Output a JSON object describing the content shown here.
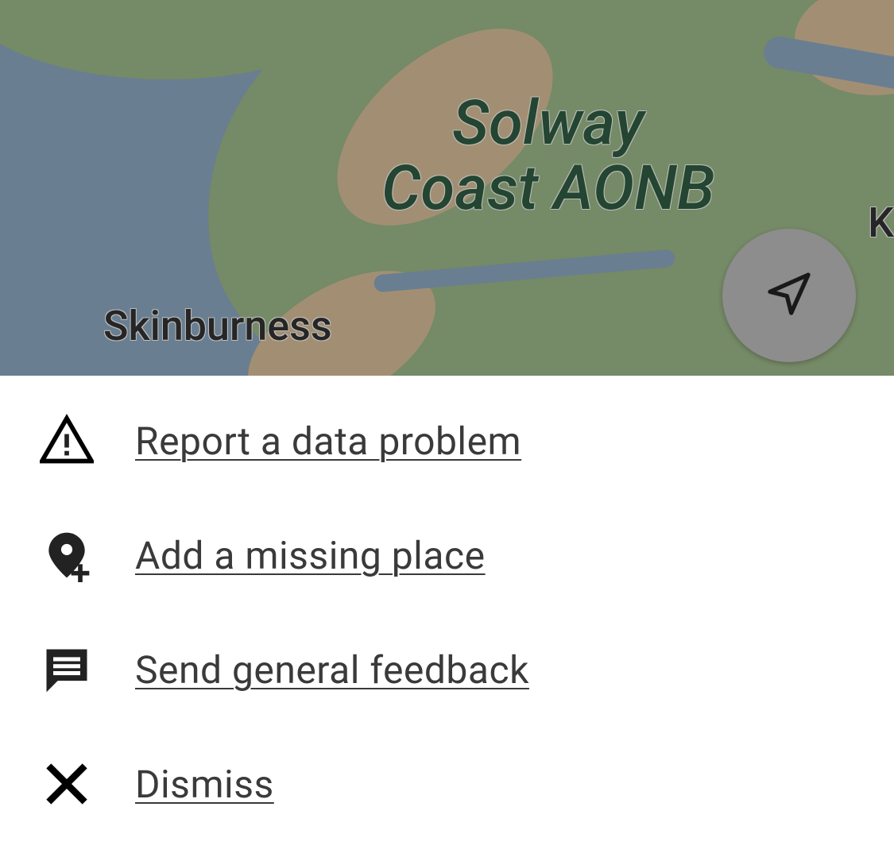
{
  "map": {
    "labels": {
      "aonb": "Solway\nCoast AONB",
      "town": "Skinburness",
      "edge": "K"
    }
  },
  "menu": {
    "items": [
      {
        "label": "Report a data problem"
      },
      {
        "label": "Add a missing place"
      },
      {
        "label": "Send general feedback"
      },
      {
        "label": "Dismiss"
      }
    ]
  }
}
